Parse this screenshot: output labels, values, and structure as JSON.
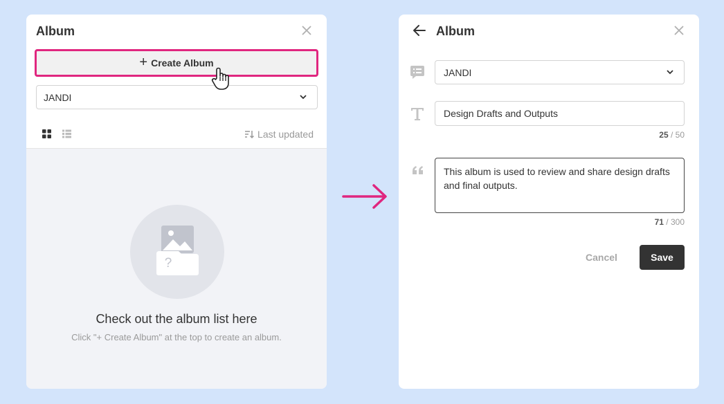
{
  "left_panel": {
    "title": "Album",
    "create_button_label": "Create Album",
    "workspace_select": "JANDI",
    "sort_label": "Last updated",
    "empty_state": {
      "title": "Check out the album list here",
      "subtitle": "Click \"+ Create Album\" at the top to create an album."
    }
  },
  "right_panel": {
    "title": "Album",
    "workspace_select": "JANDI",
    "name_value": "Design Drafts and Outputs",
    "name_count": "25",
    "name_max": " / 50",
    "description_value": "This album is used to review and share design drafts and final outputs.",
    "description_count": "71",
    "description_max": " / 300",
    "cancel_label": "Cancel",
    "save_label": "Save"
  },
  "colors": {
    "background": "#d3e4fb",
    "highlight": "#e0267f",
    "save_button": "#333333"
  }
}
